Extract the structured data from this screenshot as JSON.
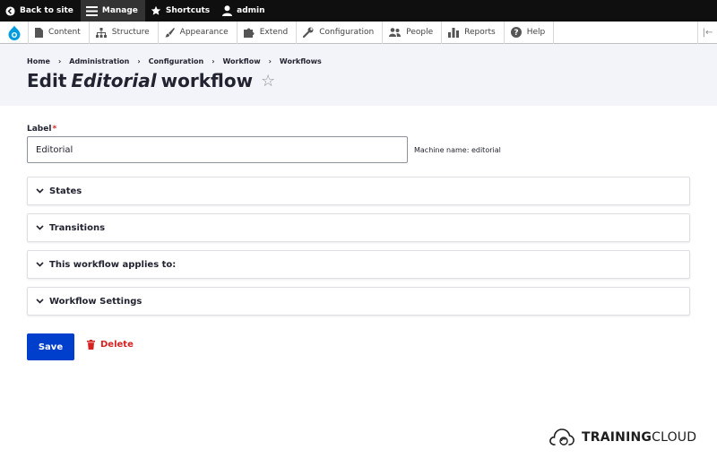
{
  "toolbar": {
    "back_to_site": "Back to site",
    "manage": "Manage",
    "shortcuts": "Shortcuts",
    "user": "admin"
  },
  "tray": {
    "items": [
      {
        "label": "Content",
        "icon": "page-icon"
      },
      {
        "label": "Structure",
        "icon": "structure-icon"
      },
      {
        "label": "Appearance",
        "icon": "paintbrush-icon"
      },
      {
        "label": "Extend",
        "icon": "puzzle-icon"
      },
      {
        "label": "Configuration",
        "icon": "wrench-icon"
      },
      {
        "label": "People",
        "icon": "people-icon"
      },
      {
        "label": "Reports",
        "icon": "bar-chart-icon"
      },
      {
        "label": "Help",
        "icon": "help-icon"
      }
    ],
    "collapse_glyph": "|←"
  },
  "breadcrumb": [
    "Home",
    "Administration",
    "Configuration",
    "Workflow",
    "Workflows"
  ],
  "breadcrumb_separator": "›",
  "page_title": {
    "prefix": "Edit",
    "name": "Editorial",
    "suffix": "workflow",
    "star": "☆"
  },
  "form": {
    "label": "Label",
    "required_mark": "*",
    "value": "Editorial",
    "machine_name": "Machine name: editorial"
  },
  "sections": [
    "States",
    "Transitions",
    "This workflow applies to:",
    "Workflow Settings"
  ],
  "actions": {
    "save": "Save",
    "delete": "Delete"
  },
  "watermark": {
    "bold": "TRAINING",
    "rest": "CLOUD"
  },
  "colors": {
    "primary": "#003ecc",
    "danger": "#d72222",
    "header_bg": "#f3f4f9",
    "toolbar_bg": "#0f0f0f"
  }
}
